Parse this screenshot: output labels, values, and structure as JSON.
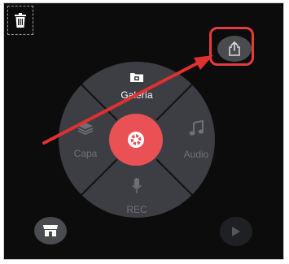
{
  "radial_menu": {
    "top_label": "Galería",
    "left_label": "Capa",
    "right_label": "Audio",
    "bottom_label": "REC"
  },
  "colors": {
    "background": "#0c0c0d",
    "ring": "#3d3e43",
    "record_button": "#e95154",
    "highlight": "#e53b3b",
    "button": "#4a4b4f"
  },
  "icons": {
    "trash": "trash-icon",
    "share": "share-icon",
    "gallery": "gallery-icon",
    "layers": "layers-icon",
    "music": "music-note-icon",
    "mic": "microphone-icon",
    "shutter": "camera-shutter-icon",
    "store": "store-icon",
    "play": "play-icon"
  }
}
